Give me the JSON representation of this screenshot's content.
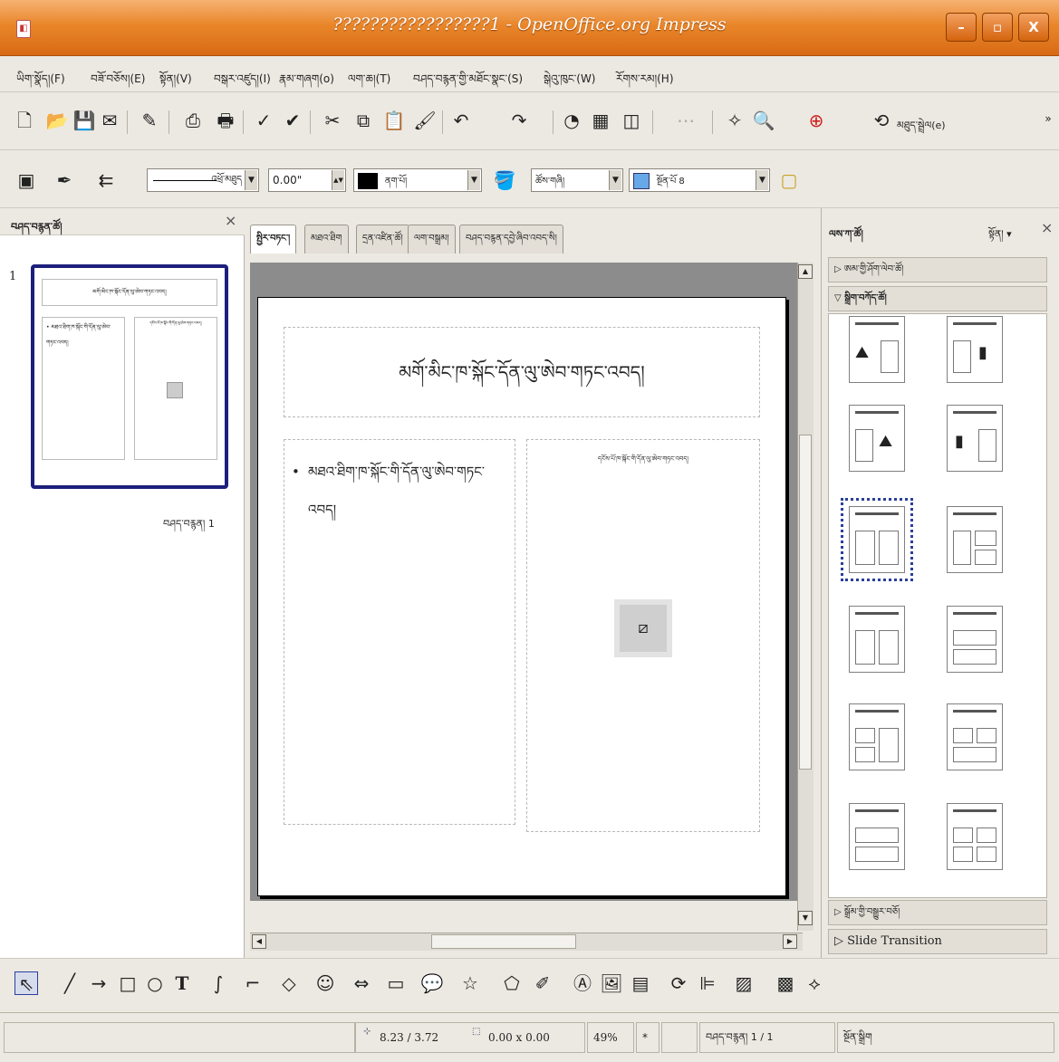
{
  "window": {
    "title": "?????????????????1 - OpenOffice.org Impress",
    "minimize": "–",
    "maximize": "▫",
    "close": "X"
  },
  "menu": [
    "ཡིག་སྣོད།(F)",
    "བཟོ་བཅོས།(E)",
    "སྟོན།(V)",
    "བསྒར་འཛུད།(I)",
    "རྣམ་གཞག(o)",
    "ལག་ཆ།(T)",
    "བཤད་བརྙན་གྱི་མཐོང་སྣང་(S)",
    "སྒེའུ་ཁུང་(W)",
    "རོགས་རམ།(H)"
  ],
  "toolbar": {
    "help_label": "མཐུད་སྦྲེལ(e)"
  },
  "lineformat": {
    "line_style": "འཕྲོ་མཐུད",
    "line_width": "0.00\"",
    "line_color": "ནག་པོ།",
    "fill_type": "ཚོས་གཞི།",
    "fill_color": "སྔོན་པོ 8"
  },
  "slides_pane": {
    "title": "བཤད་བརྙན་ཚོ།",
    "close": "×",
    "slide_number": "1",
    "slide_label": "བཤད་བརྙན། 1",
    "thumb_title": "མགོ་མིང་ཁ་སྐོང་དོན་ལུ་ཨེབ་གཏང་འབད།",
    "thumb_text": "• མཐའ་ཐིག་ཁ་སྐོང་གི་དོན་ལུ་ཨེབ་གཏང་འབད།",
    "thumb_obj": "དངོས་པོ་ཁ་སྐོང་གི་དོན་ལུ་ཨེབ་གཏང་འབད།"
  },
  "tabs": [
    "སྤྱིར་བཏང་།",
    "མཐའ་ཐིག",
    "དྲན་འཛིན་ཚོ།",
    "ལག་བསྒྲམ།",
    "བཤད་བརྙན་དབྱེ་ཞིབ་འབད་སི།"
  ],
  "slide": {
    "title_placeholder": "མགོ་མིང་ཁ་སྐོང་དོན་ལུ་ཨེབ་གཏང་འབད།",
    "text_placeholder": "མཐའ་ཐིག་ཁ་སྐོང་གི་དོན་ལུ་ཨེབ་གཏང་འབད།",
    "object_placeholder": "དངོས་པོ་ཁ་སྐོང་གི་དོན་ལུ་ཨེབ་གཏང་འབད།"
  },
  "task_pane": {
    "title": "ལས་ཀ་ཚོ།",
    "view_menu": "སྟོན། ▾",
    "close": "×",
    "master_pages": "ཨམ་གྱི་ཤོག་ལེབ་ཚོ།",
    "layouts": "སྒྲིག་བཀོད་ཚོ།",
    "custom_animation": "སྒྲོམ་གྱི་བསྒྱུར་བཅོ།",
    "slide_transition": "Slide Transition"
  },
  "status": {
    "position": "8.23 / 3.72",
    "size": "0.00 x 0.00",
    "zoom": "49%",
    "modified": "*",
    "slide_of": "བཤད་བརྙན། 1 / 1",
    "layout_name": "སྔོན་སྒྲིག"
  }
}
